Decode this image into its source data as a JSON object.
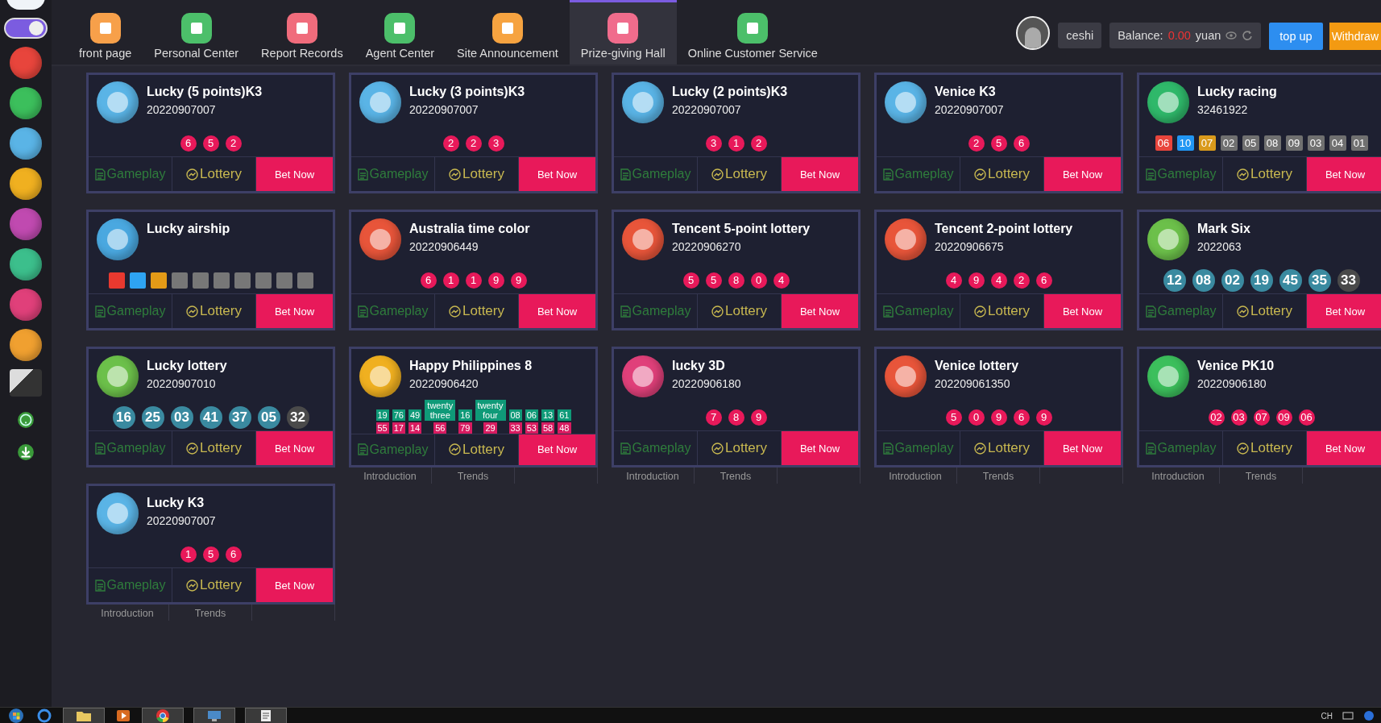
{
  "sidebar": {
    "toggle": {
      "on": true
    },
    "items": [
      {
        "color": "#e8453c"
      },
      {
        "color": "#3cbf5c"
      },
      {
        "color": "#5ab4e6"
      },
      {
        "color": "#f0b020"
      },
      {
        "color": "#c04ab0"
      },
      {
        "color": "#3cbf8c"
      },
      {
        "color": "#e0407a"
      },
      {
        "color": "#f0a030"
      }
    ]
  },
  "nav": {
    "tabs": [
      {
        "label": "front page",
        "color": "#f7a04a",
        "selected": false
      },
      {
        "label": "Personal Center",
        "color": "#4cbf6a",
        "selected": false
      },
      {
        "label": "Report Records",
        "color": "#f06c7c",
        "selected": false
      },
      {
        "label": "Agent Center",
        "color": "#4cbf6a",
        "selected": false
      },
      {
        "label": "Site Announcement",
        "color": "#f6a340",
        "selected": false
      },
      {
        "label": "Prize-giving Hall",
        "color": "#f06c8c",
        "selected": true
      },
      {
        "label": "Online Customer Service",
        "color": "#4cbf6a",
        "selected": false
      }
    ],
    "user": "ceshi",
    "balance_label": "Balance:",
    "balance": "0.00",
    "currency": "yuan",
    "top_up": "top up",
    "withdraw": "Withdraw"
  },
  "cards": [
    {
      "title": "Lucky (5 points)K3",
      "issue": "20220907007",
      "color": "#5ab4e6",
      "balls": {
        "kind": "dots",
        "items": [
          {
            "text": "6"
          },
          {
            "text": "5"
          },
          {
            "text": "2"
          }
        ]
      },
      "gameplay": "Gameplay",
      "lottery": "Lottery",
      "bet": "Bet Now"
    },
    {
      "title": "Lucky (3 points)K3",
      "issue": "20220907007",
      "color": "#5ab4e6",
      "balls": {
        "kind": "dots",
        "items": [
          {
            "text": "2"
          },
          {
            "text": "2"
          },
          {
            "text": "3"
          }
        ]
      },
      "gameplay": "Gameplay",
      "lottery": "Lottery",
      "bet": "Bet Now"
    },
    {
      "title": "Lucky (2 points)K3",
      "issue": "20220907007",
      "color": "#5ab4e6",
      "balls": {
        "kind": "dots",
        "items": [
          {
            "text": "3"
          },
          {
            "text": "1"
          },
          {
            "text": "2"
          }
        ]
      },
      "gameplay": "Gameplay",
      "lottery": "Lottery",
      "bet": "Bet Now"
    },
    {
      "title": "Venice K3",
      "issue": "20220907007",
      "color": "#5ab4e6",
      "balls": {
        "kind": "dots",
        "items": [
          {
            "text": "2"
          },
          {
            "text": "5"
          },
          {
            "text": "6"
          }
        ]
      },
      "gameplay": "Gameplay",
      "lottery": "Lottery",
      "bet": "Bet Now"
    },
    {
      "title": "Lucky racing",
      "issue": "32461922",
      "color": "#2fb86a",
      "balls": {
        "kind": "squares",
        "items": [
          {
            "text": "06",
            "color": "#e8453c"
          },
          {
            "text": "10",
            "color": "#2196f3"
          },
          {
            "text": "07",
            "color": "#d99a1c"
          },
          {
            "text": "02",
            "color": "#707070"
          },
          {
            "text": "05",
            "color": "#707070"
          },
          {
            "text": "08",
            "color": "#707070"
          },
          {
            "text": "09",
            "color": "#707070"
          },
          {
            "text": "03",
            "color": "#707070"
          },
          {
            "text": "04",
            "color": "#707070"
          },
          {
            "text": "01",
            "color": "#707070"
          }
        ]
      },
      "gameplay": "Gameplay",
      "lottery": "Lottery",
      "bet": "Bet Now"
    },
    {
      "title": "Lucky airship",
      "color": "#4aa8e0",
      "balls": {
        "kind": "squares",
        "items": [
          {
            "color": "#e8392f"
          },
          {
            "color": "#2ea3f2"
          },
          {
            "color": "#e39a17"
          },
          {
            "color": "#777777"
          },
          {
            "color": "#777777"
          },
          {
            "color": "#777777"
          },
          {
            "color": "#777777"
          },
          {
            "color": "#777777"
          },
          {
            "color": "#777777"
          },
          {
            "color": "#777777"
          }
        ]
      },
      "gameplay": "Gameplay",
      "lottery": "Lottery",
      "bet": "Bet Now"
    },
    {
      "title": "Australia time color",
      "issue": "20220906449",
      "color": "#e8553a",
      "balls": {
        "kind": "dots",
        "items": [
          {
            "text": "6"
          },
          {
            "text": "1"
          },
          {
            "text": "1"
          },
          {
            "text": "9"
          },
          {
            "text": "9"
          }
        ]
      },
      "gameplay": "Gameplay",
      "lottery": "Lottery",
      "bet": "Bet Now"
    },
    {
      "title": "Tencent 5-point lottery",
      "issue": "20220906270",
      "color": "#e8553a",
      "balls": {
        "kind": "dots",
        "items": [
          {
            "text": "5"
          },
          {
            "text": "5"
          },
          {
            "text": "8"
          },
          {
            "text": "0"
          },
          {
            "text": "4"
          }
        ]
      },
      "gameplay": "Gameplay",
      "lottery": "Lottery",
      "bet": "Bet Now"
    },
    {
      "title": "Tencent 2-point lottery",
      "issue": "20220906675",
      "color": "#e8553a",
      "balls": {
        "kind": "dots",
        "items": [
          {
            "text": "4"
          },
          {
            "text": "9"
          },
          {
            "text": "4"
          },
          {
            "text": "2"
          },
          {
            "text": "6"
          }
        ]
      },
      "gameplay": "Gameplay",
      "lottery": "Lottery",
      "bet": "Bet Now"
    },
    {
      "title": "Mark Six",
      "issue": "2022063",
      "color": "#6cc04a",
      "balls": {
        "kind": "balls",
        "items": [
          {
            "text": "12",
            "color": "#3a8aa0"
          },
          {
            "text": "08",
            "color": "#3a8aa0"
          },
          {
            "text": "02",
            "color": "#3a8aa0"
          },
          {
            "text": "19",
            "color": "#3a8aa0"
          },
          {
            "text": "45",
            "color": "#3a8aa0"
          },
          {
            "text": "35",
            "color": "#3a8aa0"
          },
          {
            "text": "33",
            "color": "#4a4a4a"
          }
        ]
      },
      "gameplay": "Gameplay",
      "lottery": "Lottery",
      "bet": "Bet Now"
    },
    {
      "title": "Lucky lottery",
      "issue": "20220907010",
      "color": "#6cc04a",
      "balls": {
        "kind": "balls",
        "items": [
          {
            "text": "16",
            "color": "#3a8aa0"
          },
          {
            "text": "25",
            "color": "#3a8aa0"
          },
          {
            "text": "03",
            "color": "#3a8aa0"
          },
          {
            "text": "41",
            "color": "#3a8aa0"
          },
          {
            "text": "37",
            "color": "#3a8aa0"
          },
          {
            "text": "05",
            "color": "#3a8aa0"
          },
          {
            "text": "32",
            "color": "#4a4a4a"
          }
        ]
      },
      "gameplay": "Gameplay",
      "lottery": "Lottery",
      "bet": "Bet Now"
    },
    {
      "title": "Happy Philippines 8",
      "issue": "20220906420",
      "color": "#f0b020",
      "balls": {
        "kind": "tiles",
        "items": [
          {
            "text": "19",
            "color": "#0f9a78"
          },
          {
            "text": "76",
            "color": "#0f9a78"
          },
          {
            "text": "49",
            "color": "#0f9a78"
          },
          {
            "text": "twenty three",
            "color": "#0f9a78"
          },
          {
            "text": "16",
            "color": "#0f9a78"
          },
          {
            "text": "twenty four",
            "color": "#0f9a78"
          },
          {
            "text": "08",
            "color": "#0f9a78"
          },
          {
            "text": "06",
            "color": "#0f9a78"
          },
          {
            "text": "13",
            "color": "#0f9a78"
          },
          {
            "text": "61",
            "color": "#0f9a78"
          },
          {
            "text": "55",
            "color": "#d81b60"
          },
          {
            "text": "17",
            "color": "#d81b60"
          },
          {
            "text": "14",
            "color": "#d81b60"
          },
          {
            "text": "56",
            "color": "#d81b60"
          },
          {
            "text": "79",
            "color": "#d81b60"
          },
          {
            "text": "29",
            "color": "#d81b60"
          },
          {
            "text": "33",
            "color": "#d81b60"
          },
          {
            "text": "53",
            "color": "#d81b60"
          },
          {
            "text": "58",
            "color": "#d81b60"
          },
          {
            "text": "48",
            "color": "#d81b60"
          }
        ]
      },
      "gameplay": "Gameplay",
      "lottery": "Lottery",
      "bet": "Bet Now",
      "links": [
        "Introduction",
        "Trends"
      ]
    },
    {
      "title": "lucky 3D",
      "issue": "20220906180",
      "color": "#e0407a",
      "balls": {
        "kind": "dots",
        "items": [
          {
            "text": "7"
          },
          {
            "text": "8"
          },
          {
            "text": "9"
          }
        ]
      },
      "gameplay": "Gameplay",
      "lottery": "Lottery",
      "bet": "Bet Now",
      "links": [
        "Introduction",
        "Trends"
      ]
    },
    {
      "title": "Venice lottery",
      "issue": "202209061350",
      "color": "#e8553a",
      "balls": {
        "kind": "dots",
        "items": [
          {
            "text": "5"
          },
          {
            "text": "0"
          },
          {
            "text": "9"
          },
          {
            "text": "6"
          },
          {
            "text": "9"
          }
        ]
      },
      "gameplay": "Gameplay",
      "lottery": "Lottery",
      "bet": "Bet Now",
      "links": [
        "Introduction",
        "Trends"
      ]
    },
    {
      "title": "Venice PK10",
      "issue": "20220906180",
      "color": "#3cbf5c",
      "balls": {
        "kind": "dots",
        "items": [
          {
            "text": "02"
          },
          {
            "text": "03"
          },
          {
            "text": "07"
          },
          {
            "text": "09"
          },
          {
            "text": "06"
          }
        ]
      },
      "gameplay": "Gameplay",
      "lottery": "Lottery",
      "bet": "Bet Now",
      "links": [
        "Introduction",
        "Trends"
      ]
    },
    {
      "title": "Lucky K3",
      "issue": "20220907007",
      "color": "#5ab4e6",
      "balls": {
        "kind": "dots",
        "items": [
          {
            "text": "1"
          },
          {
            "text": "5"
          },
          {
            "text": "6"
          }
        ]
      },
      "gameplay": "Gameplay",
      "lottery": "Lottery",
      "bet": "Bet Now",
      "links": [
        "Introduction",
        "Trends"
      ]
    }
  ],
  "taskbar": {
    "language": "CH"
  }
}
